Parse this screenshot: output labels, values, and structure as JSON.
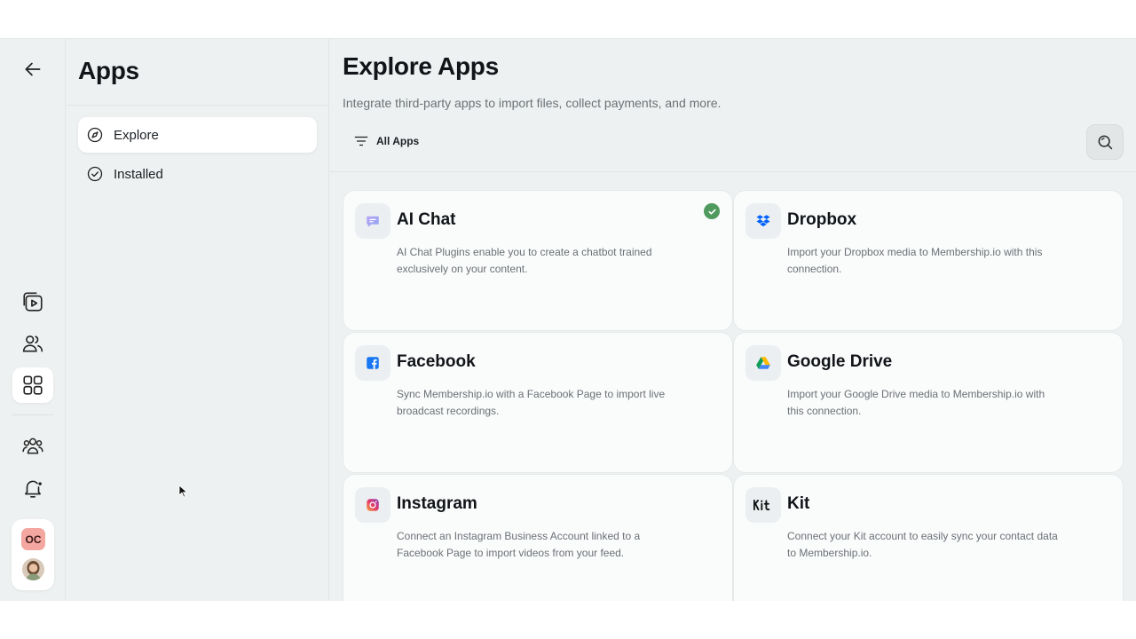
{
  "sidebar": {
    "title": "Apps",
    "nav": [
      {
        "label": "Explore",
        "icon": "compass-icon",
        "active": true
      },
      {
        "label": "Installed",
        "icon": "check-circle-icon",
        "active": false
      }
    ]
  },
  "rail": {
    "items": [
      {
        "icon": "back-arrow-icon"
      },
      {
        "icon": "video-library-icon"
      },
      {
        "icon": "users-icon"
      },
      {
        "icon": "apps-grid-icon",
        "active": true
      },
      {
        "icon": "community-icon"
      },
      {
        "icon": "notification-bell-icon"
      }
    ],
    "profile_badge": "OC"
  },
  "main": {
    "title": "Explore Apps",
    "subtitle": "Integrate third-party apps to import files, collect payments, and more.",
    "filter_label": "All Apps"
  },
  "apps": [
    {
      "name": "AI Chat",
      "description": "AI Chat Plugins enable you to create a chatbot trained exclusively on your content.",
      "icon": "chat-bubble-icon",
      "installed": true
    },
    {
      "name": "Dropbox",
      "description": "Import your Dropbox media to Membership.io with this connection.",
      "icon": "dropbox-icon",
      "installed": false
    },
    {
      "name": "Facebook",
      "description": "Sync Membership.io with a Facebook Page to import live broadcast recordings.",
      "icon": "facebook-icon",
      "installed": false
    },
    {
      "name": "Google Drive",
      "description": "Import your Google Drive media to Membership.io with this connection.",
      "icon": "google-drive-icon",
      "installed": false
    },
    {
      "name": "Instagram",
      "description": "Connect an Instagram Business Account linked to a Facebook Page to import videos from your feed.",
      "icon": "instagram-icon",
      "installed": false
    },
    {
      "name": "Kit",
      "description": "Connect your Kit account to easily sync your contact data to Membership.io.",
      "icon": "kit-icon",
      "installed": false
    }
  ],
  "colors": {
    "background": "#eef1f1",
    "card": "#fafbfb",
    "installed_check": "#4f9a5e",
    "profile_badge": "#f4a6a0",
    "facebook": "#1877f2",
    "dropbox": "#0061fe"
  }
}
